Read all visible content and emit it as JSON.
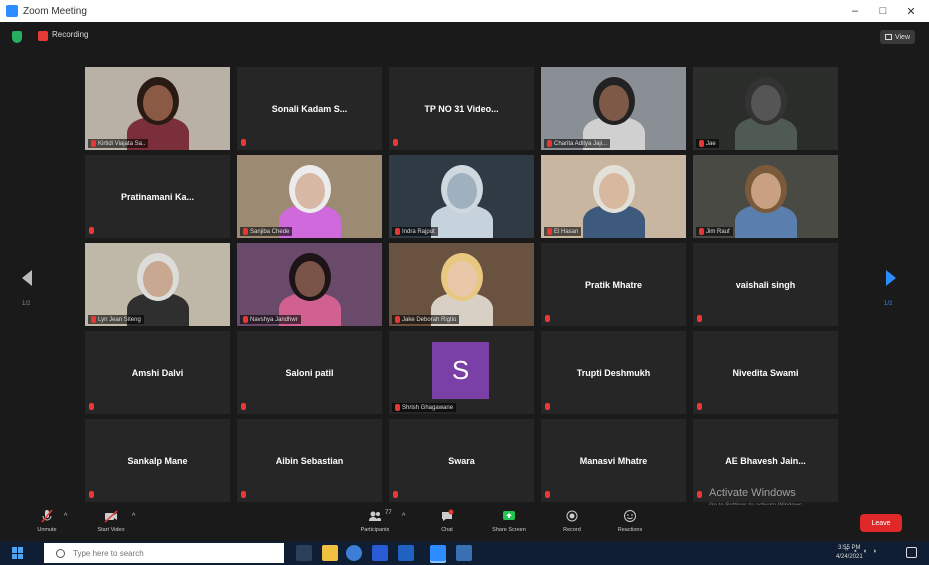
{
  "window": {
    "title": "Zoom Meeting",
    "controls": [
      "–",
      "□",
      "✕"
    ]
  },
  "topbar": {
    "recording_label": "Recording",
    "view_label": "View"
  },
  "gallery": {
    "tiles": [
      {
        "name": "Kirtidi Viajata Sa..",
        "video": true,
        "bg": "#b9b1a6",
        "skin": "#8a5a44",
        "hair": "#2a1a14",
        "cloth": "#7a2f3a",
        "speaking": true
      },
      {
        "name": "Sonali Kadam S...",
        "video": false
      },
      {
        "name": "TP NO 31 Video...",
        "video": false
      },
      {
        "name": "Charita Aditya Jaji...",
        "video": true,
        "bg": "#8a8f96",
        "skin": "#7d5a48",
        "hair": "#222",
        "cloth": "#d0d0d0"
      },
      {
        "name": "Jae",
        "video": true,
        "bg": "#2a2d2a",
        "skin": "#555",
        "hair": "#333",
        "cloth": "#4f5a52"
      },
      {
        "name": "Pratinamani Ka...",
        "video": false
      },
      {
        "name": "Sanjiba Chede",
        "video": true,
        "bg": "#9c8a72",
        "skin": "#d7b8a4",
        "hair": "#ececec",
        "cloth": "#d06adc"
      },
      {
        "name": "Indra Rajput",
        "video": true,
        "bg": "#2f3a44",
        "skin": "#9fb1bf",
        "hair": "#cfd8df",
        "cloth": "#c7d3dc"
      },
      {
        "name": "El Hasan",
        "video": true,
        "bg": "#c9b6a0",
        "skin": "#d8b9a0",
        "hair": "#e3e0d8",
        "cloth": "#3d5a7c"
      },
      {
        "name": "Jim Rauf",
        "video": true,
        "bg": "#4a4a44",
        "skin": "#c9a082",
        "hair": "#7a5a3a",
        "cloth": "#5a7fae"
      },
      {
        "name": "Lyn Jean Siteng",
        "video": true,
        "bg": "#bfb8a8",
        "skin": "#c8a890",
        "hair": "#dcdcd8",
        "cloth": "#2f2f30"
      },
      {
        "name": "Navshya Jandhwr",
        "video": true,
        "bg": "#6a4a6a",
        "skin": "#7a5448",
        "hair": "#1e1418",
        "cloth": "#d06090"
      },
      {
        "name": "Jake Deborah Rigtio",
        "video": true,
        "bg": "#6a5240",
        "skin": "#e8c8a8",
        "hair": "#e8c880",
        "cloth": "#d8d0c4"
      },
      {
        "name": "Pratik Mhatre",
        "video": false
      },
      {
        "name": "vaishali singh",
        "video": false
      },
      {
        "name": "Amshi Dalvi",
        "video": false
      },
      {
        "name": "Saloni patil",
        "video": false
      },
      {
        "name": "Shrish Ghagawane",
        "video": false,
        "avatar": "S"
      },
      {
        "name": "Trupti Deshmukh",
        "video": false
      },
      {
        "name": "Nivedita Swami",
        "video": false
      },
      {
        "name": "Sankalp Mane",
        "video": false
      },
      {
        "name": "Aibin Sebastian",
        "video": false
      },
      {
        "name": "Swara",
        "video": false
      },
      {
        "name": "Manasvi Mhatre",
        "video": false
      },
      {
        "name": "AE Bhavesh Jain...",
        "video": false
      }
    ],
    "page_left": "1/2",
    "page_right": "1/2"
  },
  "watermark": {
    "title": "Activate Windows",
    "subtitle": "Go to Settings to activate Windows."
  },
  "toolbar": {
    "unmute": "Unmute",
    "start_video": "Start Video",
    "participants": "Participants",
    "participants_count": "77",
    "chat": "Chat",
    "share_screen": "Share Screen",
    "record": "Record",
    "reactions": "Reactions",
    "end": "Leave"
  },
  "taskbar": {
    "search_placeholder": "Type here to search",
    "time": "3:55 PM",
    "date": "4/24/2021"
  },
  "colors": {
    "accent": "#2d8cff",
    "end": "#e02828",
    "speaking_border": "#c9d96a",
    "avatar": "#7b3fa8"
  }
}
